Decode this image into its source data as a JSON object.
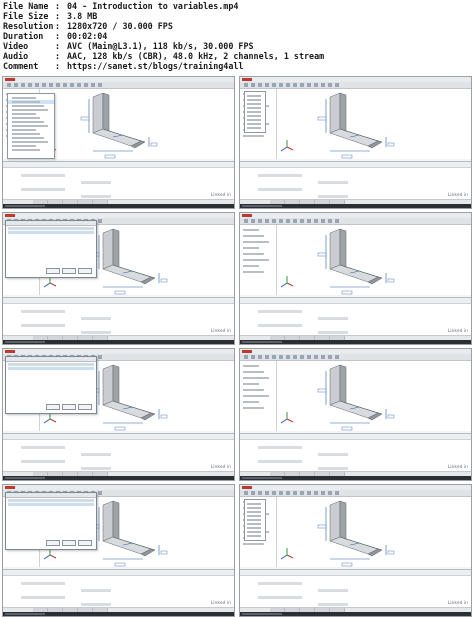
{
  "info": [
    {
      "key": "File Name",
      "sep": ":",
      "value": "04 - Introduction to variables.mp4"
    },
    {
      "key": "File Size",
      "sep": ":",
      "value": "3.8 MB"
    },
    {
      "key": "Resolution",
      "sep": ":",
      "value": "1280x720 / 30.000 FPS"
    },
    {
      "key": "Duration",
      "sep": ":",
      "value": "00:02:04"
    },
    {
      "key": "Video",
      "sep": ":",
      "value": "AVC (Main@L3.1), 118 kb/s, 30.000 FPS"
    },
    {
      "key": "Audio",
      "sep": ":",
      "value": "AAC, 128 kb/s (CBR), 48.0 kHz, 2 channels, 1 stream"
    },
    {
      "key": "Comment",
      "sep": ":",
      "value": "https://sanet.st/blogs/training4all"
    }
  ],
  "thumbnails": [
    {
      "overlay": "context-menu",
      "watermark": "Linked in"
    },
    {
      "overlay": "side-popup",
      "watermark": "Linked in"
    },
    {
      "overlay": "variables-dialog",
      "watermark": "Linked in"
    },
    {
      "overlay": "none",
      "watermark": "Linked in"
    },
    {
      "overlay": "variables-dialog",
      "watermark": "Linked in"
    },
    {
      "overlay": "none",
      "watermark": "Linked in"
    },
    {
      "overlay": "variables-dialog",
      "watermark": "Linked in"
    },
    {
      "overlay": "side-popup",
      "watermark": "Linked in"
    }
  ]
}
